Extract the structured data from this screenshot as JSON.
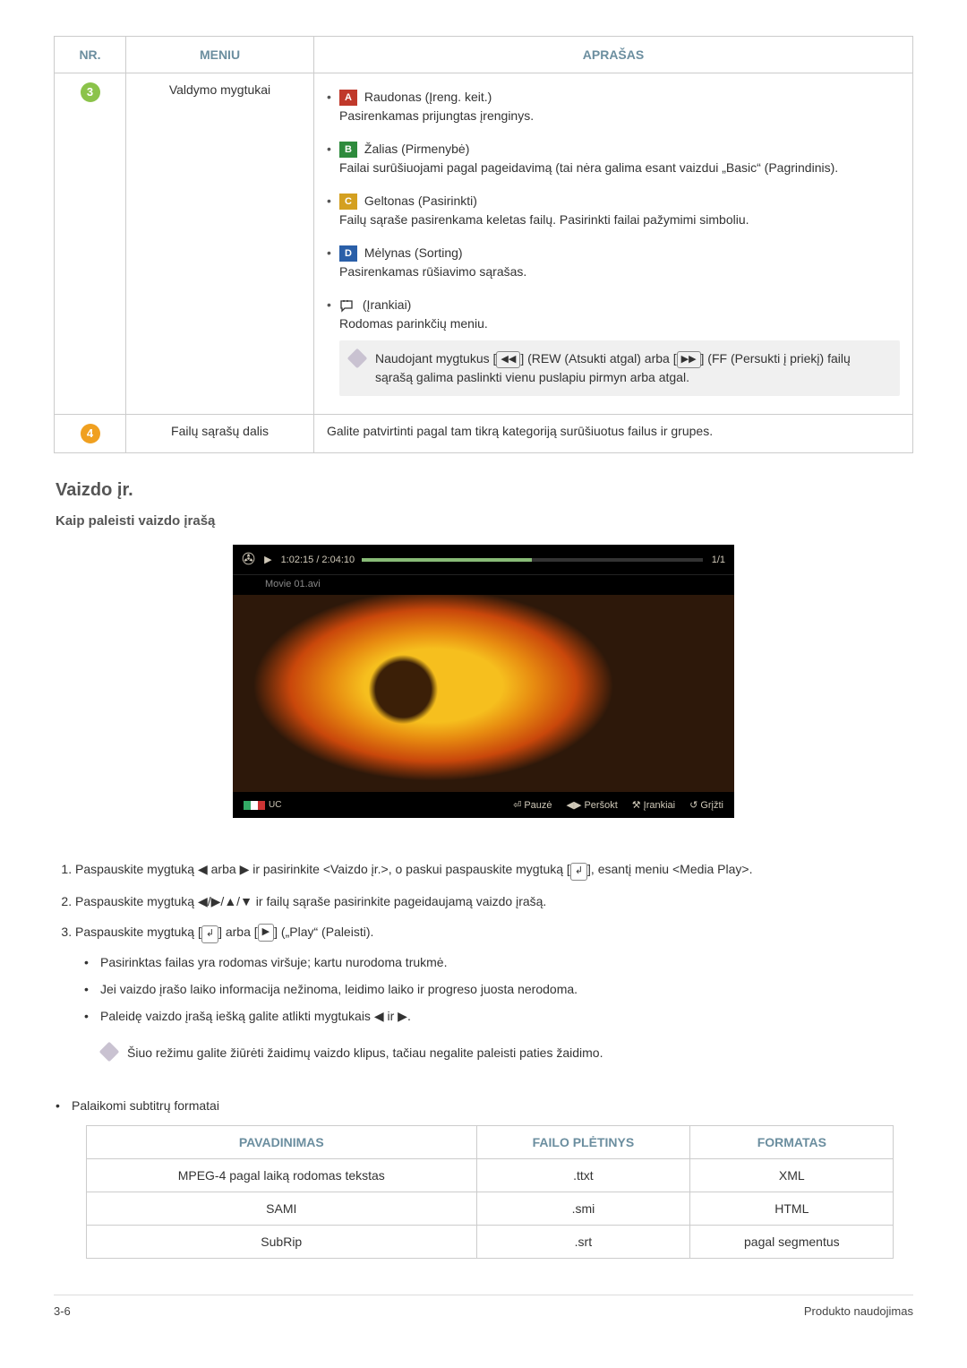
{
  "table1": {
    "headers": {
      "nr": "NR.",
      "menu": "MENIU",
      "desc": "APRAŠAS"
    },
    "rows": [
      {
        "badge": "3",
        "menu": "Valdymo mygtukai",
        "items": {
          "red_title": "Raudonas (Įreng. keit.)",
          "red_text": "Pasirenkamas prijungtas įrenginys.",
          "green_title": "Žalias (Pirmenybė)",
          "green_text": "Failai surūšiuojami pagal pageidavimą (tai nėra galima esant vaizdui „Basic“ (Pagrindinis).",
          "yellow_title": "Geltonas (Pasirinkti)",
          "yellow_text": "Failų sąraše pasirenkama keletas failų. Pasirinkti failai pažymimi simboliu.",
          "blue_title": "Mėlynas (Sorting)",
          "blue_text": "Pasirenkamas rūšiavimo sąrašas.",
          "tools_title": "(Įrankiai)",
          "tools_text": "Rodomas parinkčių meniu.",
          "note_a": "Naudojant mygtukus [",
          "note_b": "] (REW (Atsukti atgal) arba [",
          "note_c": "] (FF (Persukti į priekį) failų sąrašą galima paslinkti vienu puslapiu pirmyn arba atgal."
        }
      },
      {
        "badge": "4",
        "menu": "Failų sąrašų dalis",
        "desc": "Galite patvirtinti pagal tam tikrą kategoriją surūšiuotus failus ir grupes."
      }
    ]
  },
  "section_title": "Vaizdo įr.",
  "sub_title": "Kaip paleisti vaizdo įrašą",
  "player": {
    "time": "1:02:15 / 2:04:10",
    "count": "1/1",
    "file": "Movie 01.avi",
    "uc": "UC",
    "pause": "Pauzė",
    "jump": "Peršokt",
    "tools": "Įrankiai",
    "back": "Grįžti"
  },
  "steps": {
    "s1a": "Paspauskite mygtuką ",
    "s1b": " arba ",
    "s1c": " ir pasirinkite <Vaizdo įr.>, o paskui paspauskite mygtuką [",
    "s1d": "], esantį meniu <Media Play>.",
    "s2a": "Paspauskite mygtuką ",
    "s2b": " ir failų sąraše pasirinkite pageidaujamą vaizdo įrašą.",
    "s3a": "Paspauskite mygtuką [",
    "s3b": "] arba [",
    "s3c": "] („Play“ (Paleisti).",
    "b1": "Pasirinktas failas yra rodomas viršuje; kartu nurodoma trukmė.",
    "b2": "Jei vaizdo įrašo laiko informacija nežinoma, leidimo laiko ir progreso juosta nerodoma.",
    "b3a": "Paleidę vaizdo įrašą iešką galite atlikti mygtukais ",
    "b3b": " ir ",
    "b3c": ".",
    "note": "Šiuo režimu galite žiūrėti žaidimų vaizdo klipus, tačiau negalite paleisti paties žaidimo.",
    "sub_formats": "Palaikomi subtitrų formatai"
  },
  "fmt_table": {
    "headers": {
      "name": "PAVADINIMAS",
      "ext": "FAILO PLĖTINYS",
      "fmt": "FORMATAS"
    },
    "rows": [
      {
        "name": "MPEG-4 pagal laiką rodomas tekstas",
        "ext": ".ttxt",
        "fmt": "XML"
      },
      {
        "name": "SAMI",
        "ext": ".smi",
        "fmt": "HTML"
      },
      {
        "name": "SubRip",
        "ext": ".srt",
        "fmt": "pagal segmentus"
      }
    ]
  },
  "footer": {
    "left": "3-6",
    "right": "Produkto naudojimas"
  },
  "glyphs": {
    "tri_left": "◀",
    "tri_right": "▶",
    "tri_up": "▲",
    "tri_down": "▼",
    "rew": "◀◀",
    "ff": "▶▶",
    "play_box": "▶",
    "enter": "↲",
    "lr": "◀▶",
    "return": "↺",
    "tools": "⚒",
    "pause": "⏎"
  }
}
